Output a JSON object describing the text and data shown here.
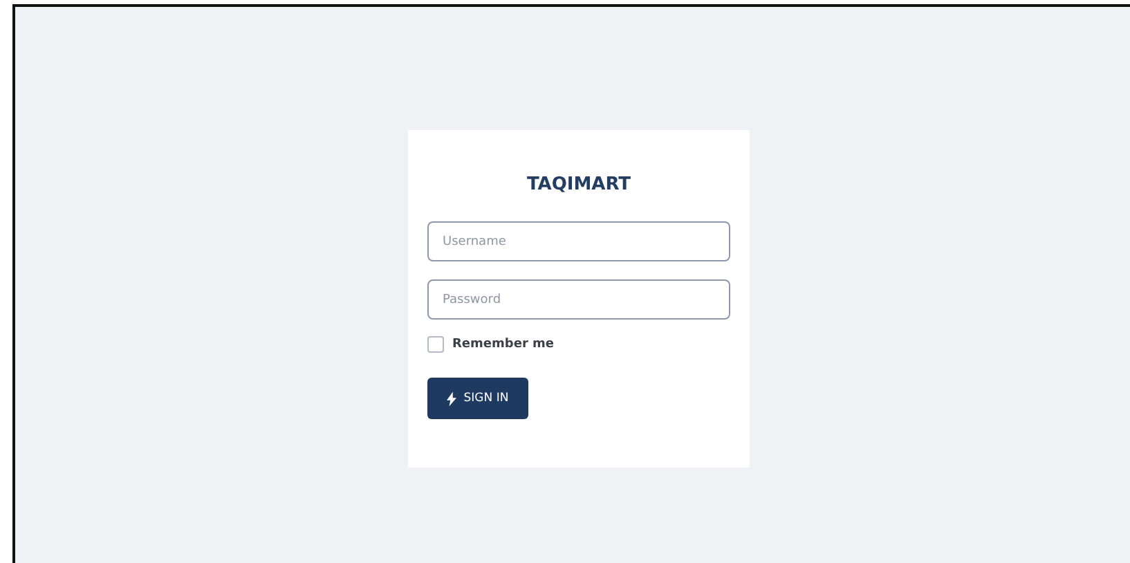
{
  "brand": "TAQIMART",
  "username": {
    "placeholder": "Username"
  },
  "password": {
    "placeholder": "Password"
  },
  "remember": {
    "label": "Remember me",
    "checked": false
  },
  "sign_in": {
    "label": "SIGN IN"
  }
}
